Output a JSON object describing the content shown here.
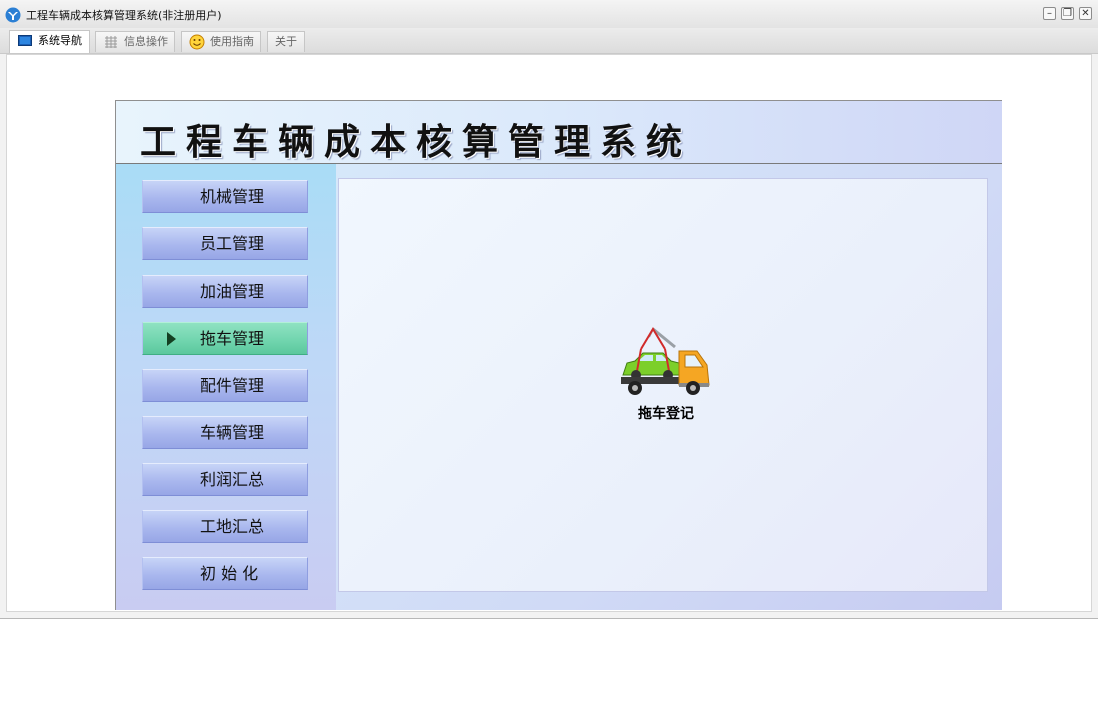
{
  "window": {
    "title": "工程车辆成本核算管理系统(非注册用户)",
    "controls": {
      "minimize": "–",
      "restore": "❐",
      "close": "✕"
    }
  },
  "tabs": [
    {
      "label": "系统导航",
      "icon": "monitor-icon",
      "active": true
    },
    {
      "label": "信息操作",
      "icon": "grid-icon",
      "active": false
    },
    {
      "label": "使用指南",
      "icon": "smiley-icon",
      "active": false
    },
    {
      "label": "关于",
      "icon": "",
      "active": false
    }
  ],
  "banner": {
    "title": "工程车辆成本核算管理系统"
  },
  "sidebar": {
    "items": [
      {
        "label": "机械管理"
      },
      {
        "label": "员工管理"
      },
      {
        "label": "加油管理"
      },
      {
        "label": "拖车管理",
        "active": true
      },
      {
        "label": "配件管理"
      },
      {
        "label": "车辆管理"
      },
      {
        "label": "利润汇总"
      },
      {
        "label": "工地汇总"
      },
      {
        "label": "初 始 化"
      }
    ]
  },
  "main": {
    "functions": [
      {
        "label": "拖车登记",
        "icon": "tow-truck-icon"
      }
    ]
  },
  "colors": {
    "active_nav": "#6fd4ad",
    "nav_button": "#a9b7ee",
    "truck_body": "#f5a623",
    "car_body": "#7ccf2a"
  }
}
